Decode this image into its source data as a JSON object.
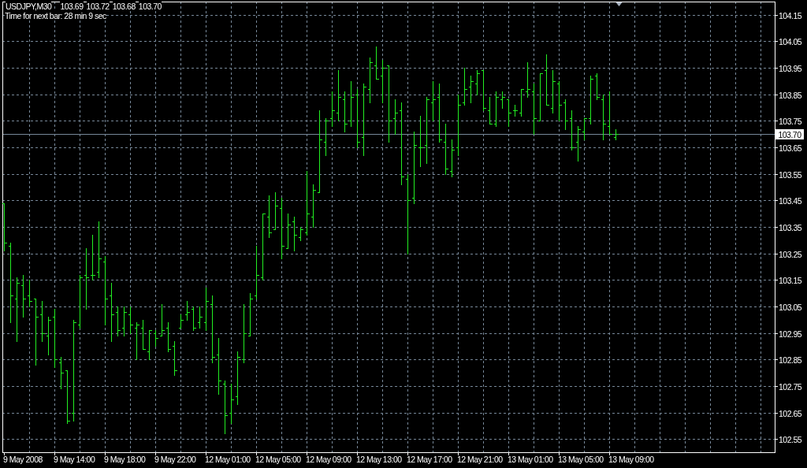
{
  "chart": {
    "header": {
      "symbol": "USDJPY,M30",
      "prices": [
        "103.69",
        "103.72",
        "103.68",
        "103.70"
      ]
    },
    "timer": "Time for next bar: 28 min 9 sec",
    "bid_label": "103.70",
    "price_axis": [
      "104.15",
      "104.05",
      "103.95",
      "103.85",
      "103.75",
      "103.65",
      "103.55",
      "103.45",
      "103.35",
      "103.25",
      "103.15",
      "103.05",
      "102.95",
      "102.85",
      "102.75",
      "102.65",
      "102.55"
    ],
    "time_axis": [
      "9 May 2008",
      "9 May 14:00",
      "9 May 18:00",
      "9 May 22:00",
      "12 May 01:00",
      "12 May 05:00",
      "12 May 09:00",
      "12 May 13:00",
      "12 May 17:00",
      "12 May 21:00",
      "13 May 01:00",
      "13 May 05:00",
      "13 May 09:00"
    ]
  }
}
